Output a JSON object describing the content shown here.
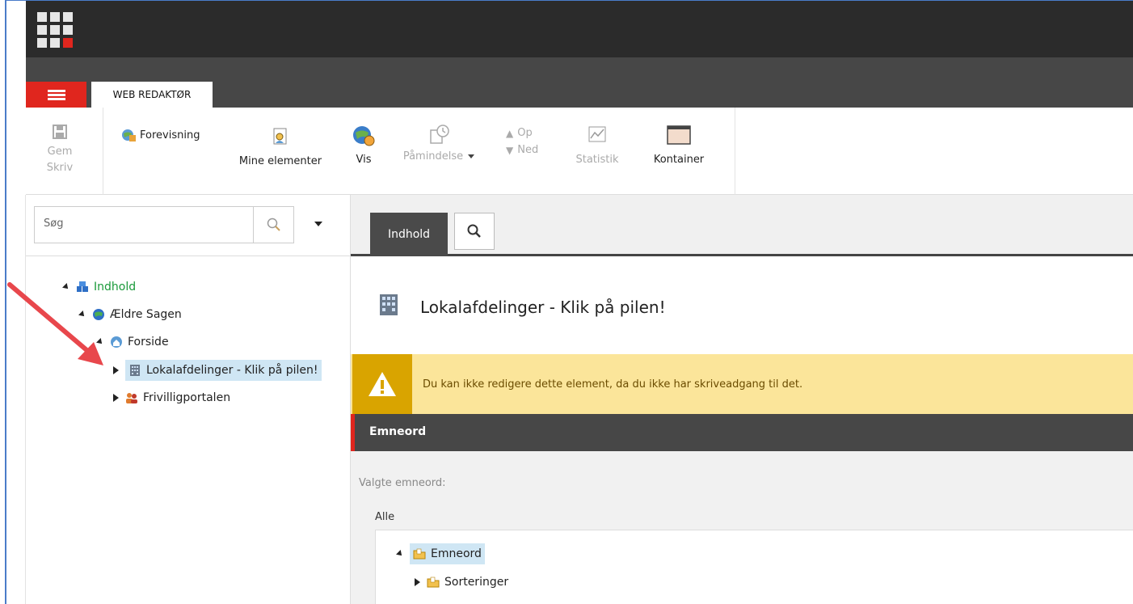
{
  "ribbon_tabs": {
    "active": "WEB REDAKTØR"
  },
  "ribbon": {
    "save": {
      "line1": "Gem",
      "line2": "Skriv"
    },
    "preview": "Forevisning",
    "my_items": "Mine elementer",
    "show": "Vis",
    "reminder": "Påmindelse",
    "up": "Op",
    "down": "Ned",
    "statistics": "Statistik",
    "container": "Kontainer"
  },
  "search": {
    "placeholder": "Søg"
  },
  "tree": {
    "root": "Indhold",
    "site": "Ældre Sagen",
    "home": "Forside",
    "selected": "Lokalafdelinger - Klik på pilen!",
    "sibling": "Frivilligportalen"
  },
  "content_tabs": {
    "content": "Indhold"
  },
  "page": {
    "title": "Lokalafdelinger - Klik på pilen!",
    "warning": "Du kan ikke redigere dette element, da du ikke har skriveadgang til det."
  },
  "section": {
    "title": "Emneord",
    "selected_label": "Valgte emneord:",
    "all_label": "Alle",
    "tree_root": "Emneord",
    "tree_child": "Sorteringer"
  },
  "colors": {
    "accent_red": "#e0261e",
    "dark": "#2b2b2b",
    "warning_bg": "#fbe59a",
    "warning_icon": "#d9a400",
    "selected": "#cfe6f4",
    "annotation_arrow": "#e8474c"
  }
}
